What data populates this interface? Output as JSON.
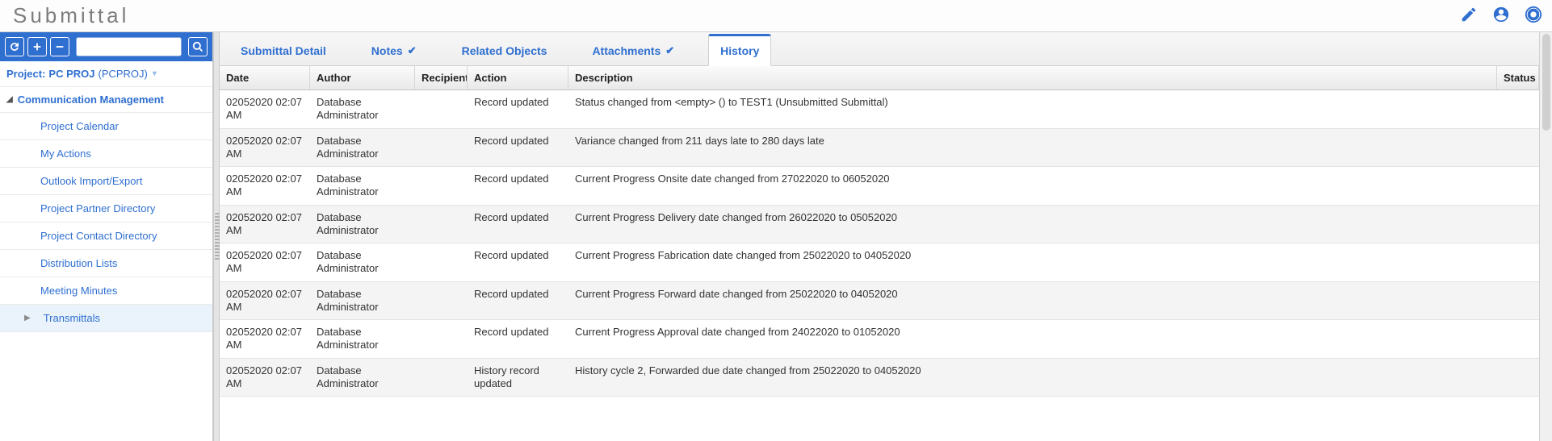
{
  "header": {
    "title": "Submittal"
  },
  "sidebar": {
    "project_label": "Project:",
    "project_name": "PC PROJ",
    "project_code": "(PCPROJ)",
    "group_label": "Communication Management",
    "items": [
      {
        "label": "Project Calendar"
      },
      {
        "label": "My Actions"
      },
      {
        "label": "Outlook Import/Export"
      },
      {
        "label": "Project Partner Directory"
      },
      {
        "label": "Project Contact Directory"
      },
      {
        "label": "Distribution Lists"
      },
      {
        "label": "Meeting Minutes"
      },
      {
        "label": "Transmittals",
        "expandable": true,
        "selected": true
      }
    ]
  },
  "tabs": [
    {
      "label": "Submittal Detail"
    },
    {
      "label": "Notes",
      "check": true
    },
    {
      "label": "Related Objects"
    },
    {
      "label": "Attachments",
      "check": true
    },
    {
      "label": "History",
      "active": true
    }
  ],
  "grid": {
    "headers": {
      "date": "Date",
      "author": "Author",
      "recipient": "Recipient",
      "action": "Action",
      "description": "Description",
      "status": "Status"
    },
    "rows": [
      {
        "date": "02052020 02:07 AM",
        "author": "Database Administrator",
        "recipient": "",
        "action": "Record updated",
        "description": "Status changed from <empty> () to TEST1 (Unsubmitted Submittal)",
        "status": ""
      },
      {
        "date": "02052020 02:07 AM",
        "author": "Database Administrator",
        "recipient": "",
        "action": "Record updated",
        "description": "Variance changed from 211 days late to 280 days late",
        "status": ""
      },
      {
        "date": "02052020 02:07 AM",
        "author": "Database Administrator",
        "recipient": "",
        "action": "Record updated",
        "description": "Current Progress Onsite date changed from 27022020 to 06052020",
        "status": ""
      },
      {
        "date": "02052020 02:07 AM",
        "author": "Database Administrator",
        "recipient": "",
        "action": "Record updated",
        "description": "Current Progress Delivery date changed from 26022020 to 05052020",
        "status": ""
      },
      {
        "date": "02052020 02:07 AM",
        "author": "Database Administrator",
        "recipient": "",
        "action": "Record updated",
        "description": "Current Progress Fabrication date changed from 25022020 to 04052020",
        "status": ""
      },
      {
        "date": "02052020 02:07 AM",
        "author": "Database Administrator",
        "recipient": "",
        "action": "Record updated",
        "description": "Current Progress Forward date changed from 25022020 to 04052020",
        "status": ""
      },
      {
        "date": "02052020 02:07 AM",
        "author": "Database Administrator",
        "recipient": "",
        "action": "Record updated",
        "description": "Current Progress Approval date changed from 24022020 to 01052020",
        "status": ""
      },
      {
        "date": "02052020 02:07 AM",
        "author": "Database Administrator",
        "recipient": "",
        "action": "History record updated",
        "description": "History cycle 2, Forwarded due date changed from 25022020 to 04052020",
        "status": ""
      }
    ]
  }
}
